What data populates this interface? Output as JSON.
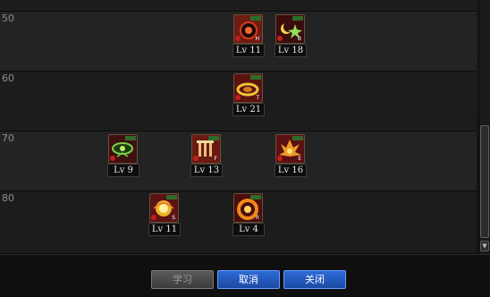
{
  "rows": [
    {
      "level_label": "50"
    },
    {
      "level_label": "60"
    },
    {
      "level_label": "70"
    },
    {
      "level_label": "80"
    }
  ],
  "skills": [
    {
      "name": "skill-50-a",
      "icon": "dark-burst-icon",
      "level": "Lv 11"
    },
    {
      "name": "skill-50-b",
      "icon": "moon-star-icon",
      "level": "Lv 18"
    },
    {
      "name": "skill-60-a",
      "icon": "golden-ring-icon",
      "level": "Lv 21"
    },
    {
      "name": "skill-70-a",
      "icon": "eye-icon",
      "level": "Lv 9"
    },
    {
      "name": "skill-70-b",
      "icon": "pillars-icon",
      "level": "Lv 13"
    },
    {
      "name": "skill-70-c",
      "icon": "flame-burst-icon",
      "level": "Lv 16"
    },
    {
      "name": "skill-80-a",
      "icon": "orb-icon",
      "level": "Lv 11"
    },
    {
      "name": "skill-80-b",
      "icon": "fire-ring-icon",
      "level": "Lv 4"
    }
  ],
  "buttons": {
    "learn": "学习",
    "cancel": "取消",
    "close": "关闭"
  },
  "colors": {
    "button_blue": "#1a4aa3",
    "button_disabled": "#4a4a4a",
    "icon_border": "#6b4f3a"
  }
}
